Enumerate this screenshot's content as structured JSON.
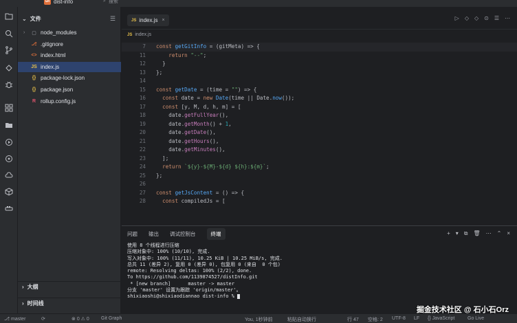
{
  "titlebar": {
    "project_badge": "DI",
    "project_name": "dist-info",
    "search_label": "搜索"
  },
  "explorer": {
    "header": "文件",
    "files": [
      {
        "name": "node_modules",
        "icon": "folder-icon",
        "glyph": "▢",
        "color": "#9da0a8",
        "chevron": "›"
      },
      {
        "name": ".gitignore",
        "icon": "git-icon",
        "glyph": "⎇",
        "color": "#e0703a",
        "chevron": ""
      },
      {
        "name": "index.html",
        "icon": "html-icon",
        "glyph": "<>",
        "color": "#e0703a",
        "chevron": ""
      },
      {
        "name": "index.js",
        "icon": "js-icon",
        "glyph": "JS",
        "color": "#e8c14a",
        "chevron": ""
      },
      {
        "name": "package-lock.json",
        "icon": "json-icon",
        "glyph": "{}",
        "color": "#e8c14a",
        "chevron": ""
      },
      {
        "name": "package.json",
        "icon": "json-icon",
        "glyph": "{}",
        "color": "#e8c14a",
        "chevron": ""
      },
      {
        "name": "rollup.config.js",
        "icon": "rollup-icon",
        "glyph": "R",
        "color": "#e0546c",
        "chevron": ""
      }
    ],
    "outline_label": "大纲",
    "timeline_label": "时间线"
  },
  "editor": {
    "tab": {
      "label": "index.js",
      "badge": "JS",
      "close": "×"
    },
    "breadcrumb": {
      "badge": "JS",
      "label": "index.js"
    },
    "actions": [
      "▷",
      "◇",
      "◇",
      "⊙",
      "☰",
      "⋯"
    ]
  },
  "code_lines": [
    {
      "n": "7",
      "sticky": true,
      "html": "<span class='kw'>const</span> <span class='fn'>getGitInfo</span> = (gitMeta) => {"
    },
    {
      "n": "11",
      "html": "    <span class='kw'>return</span> <span class='str'>\"--\"</span>;"
    },
    {
      "n": "12",
      "html": "  }"
    },
    {
      "n": "13",
      "html": "};"
    },
    {
      "n": "14",
      "html": ""
    },
    {
      "n": "15",
      "html": "<span class='kw'>const</span> <span class='fn'>getDate</span> = (time = <span class='str'>\"\"</span>) => {"
    },
    {
      "n": "16",
      "html": "  <span class='kw'>const</span> date = <span class='kw'>new</span> <span class='fn'>Date</span>(time || Date.<span class='fn'>now</span>());"
    },
    {
      "n": "17",
      "html": "  <span class='kw'>const</span> [y, M, d, h, m] = ["
    },
    {
      "n": "18",
      "html": "    date.<span class='mth'>getFullYear</span>(),"
    },
    {
      "n": "19",
      "html": "    date.<span class='mth'>getMonth</span>() + <span class='num'>1</span>,"
    },
    {
      "n": "20",
      "html": "    date.<span class='mth'>getDate</span>(),"
    },
    {
      "n": "21",
      "html": "    date.<span class='mth'>getHours</span>(),"
    },
    {
      "n": "22",
      "html": "    date.<span class='mth'>getMinutes</span>(),"
    },
    {
      "n": "23",
      "html": "  ];"
    },
    {
      "n": "24",
      "html": "  <span class='kw'>return</span> <span class='str'>`${y}-${M}-${d} ${h}:${m}`</span>;"
    },
    {
      "n": "25",
      "html": "};"
    },
    {
      "n": "26",
      "html": ""
    },
    {
      "n": "27",
      "html": "<span class='kw'>const</span> <span class='fn'>getJsContent</span> = () => {"
    },
    {
      "n": "28",
      "html": "  <span class='kw'>const</span> compiledJs = ["
    }
  ],
  "panel": {
    "tabs": [
      "问题",
      "输出",
      "调试控制台",
      "终端"
    ],
    "active_tab": 3,
    "actions": [
      "+",
      "▾",
      "⧉",
      "🗑",
      "⋯",
      "⌃",
      "×"
    ]
  },
  "terminal_lines": [
    "使用 8 个线程进行压缩",
    "压缩对象中: 100% (10/10), 完成.",
    "写入对象中: 100% (11/11), 10.25 KiB | 10.25 MiB/s, 完成.",
    "总共 11 (差异 2), 复用 0 (差异 0), 包复用 0 (来自  0 个包)",
    "remote: Resolving deltas: 100% (2/2), done.",
    "To https://github.com/1139874527/distInfo.git",
    " * [new branch]      master -> master",
    "分支 'master' 设置为跟踪 'origin/master'。",
    "shixiaoshi@shixiaodiannao dist-info % "
  ],
  "watermark": "掘金技术社区 @ 石小石Orz",
  "statusbar": {
    "branch": "master",
    "sync": "⟳",
    "errors": "0",
    "warnings": "0",
    "git_graph": "Git Graph",
    "blame": "You, 1秒钟前",
    "position": "行 47",
    "spaces": "空格: 2",
    "encoding": "UTF-8",
    "eol": "LF",
    "language": "{} JavaScript",
    "golive": "Go Live",
    "autowrap": "粘贴自动换行"
  }
}
